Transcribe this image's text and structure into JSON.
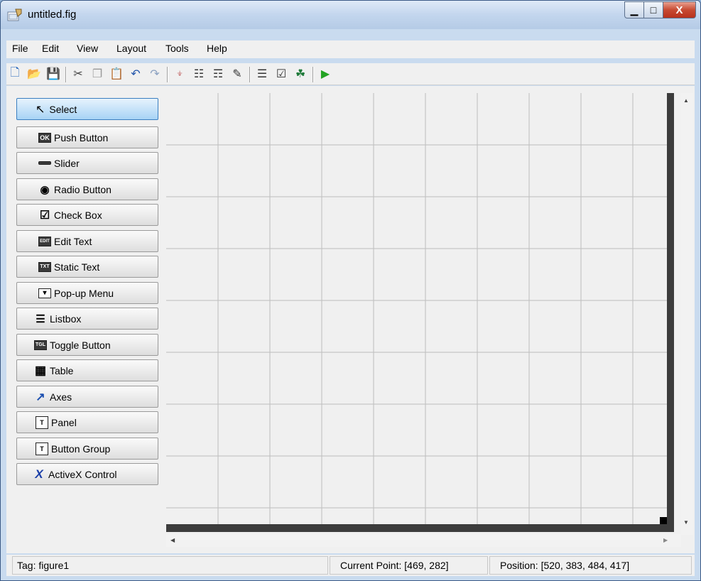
{
  "window": {
    "title": "untitled.fig",
    "minimize_glyph": "▁",
    "maximize_glyph": "□",
    "close_glyph": "X"
  },
  "menu": [
    "File",
    "Edit",
    "View",
    "Layout",
    "Tools",
    "Help"
  ],
  "toolbar": [
    {
      "name": "new-icon",
      "glyph": "🗋"
    },
    {
      "name": "open-icon",
      "glyph": "📂"
    },
    {
      "name": "save-icon",
      "glyph": "💾"
    },
    {
      "name": "cut-icon",
      "glyph": "✂"
    },
    {
      "name": "copy-icon",
      "glyph": "❐"
    },
    {
      "name": "paste-icon",
      "glyph": "📋"
    },
    {
      "name": "undo-icon",
      "glyph": "↶"
    },
    {
      "name": "redo-icon",
      "glyph": "↷"
    },
    {
      "name": "align-objects-icon",
      "glyph": "⍖"
    },
    {
      "name": "menu-editor-icon",
      "glyph": "☷"
    },
    {
      "name": "tab-order-editor-icon",
      "glyph": "☶"
    },
    {
      "name": "toolbar-editor-icon",
      "glyph": "✎"
    },
    {
      "name": "m-file-editor-icon",
      "glyph": "☰"
    },
    {
      "name": "property-inspector-icon",
      "glyph": "☑"
    },
    {
      "name": "object-browser-icon",
      "glyph": "☘"
    },
    {
      "name": "run-figure-icon",
      "glyph": "▶"
    }
  ],
  "palette": [
    {
      "label": "Select",
      "icon": "arrow-cursor-icon",
      "badge": "↖"
    },
    {
      "label": "Push Button",
      "icon": "push-button-icon",
      "badge": "OK"
    },
    {
      "label": "Slider",
      "icon": "slider-icon",
      "badge": ""
    },
    {
      "label": "Radio Button",
      "icon": "radio-button-icon",
      "badge": "◉"
    },
    {
      "label": "Check Box",
      "icon": "check-box-icon",
      "badge": "☑"
    },
    {
      "label": "Edit Text",
      "icon": "edit-text-icon",
      "badge": "EDIT"
    },
    {
      "label": "Static Text",
      "icon": "static-text-icon",
      "badge": "TXT"
    },
    {
      "label": "Pop-up Menu",
      "icon": "popup-menu-icon",
      "badge": "▾"
    },
    {
      "label": "Listbox",
      "icon": "listbox-icon",
      "badge": "☰"
    },
    {
      "label": "Toggle Button",
      "icon": "toggle-button-icon",
      "badge": "TGL"
    },
    {
      "label": "Table",
      "icon": "table-icon",
      "badge": "▦"
    },
    {
      "label": "Axes",
      "icon": "axes-icon",
      "badge": "↗"
    },
    {
      "label": "Panel",
      "icon": "panel-icon",
      "badge": "T"
    },
    {
      "label": "Button Group",
      "icon": "button-group-icon",
      "badge": "T"
    },
    {
      "label": "ActiveX Control",
      "icon": "activex-icon",
      "badge": "X"
    }
  ],
  "scroll": {
    "up": "▲",
    "down": "▼",
    "left": "◀",
    "right": "▶"
  },
  "status": {
    "tag": "Tag: figure1",
    "current_point": "Current Point:  [469, 282]",
    "position": "Position: [520, 383, 484, 417]"
  }
}
